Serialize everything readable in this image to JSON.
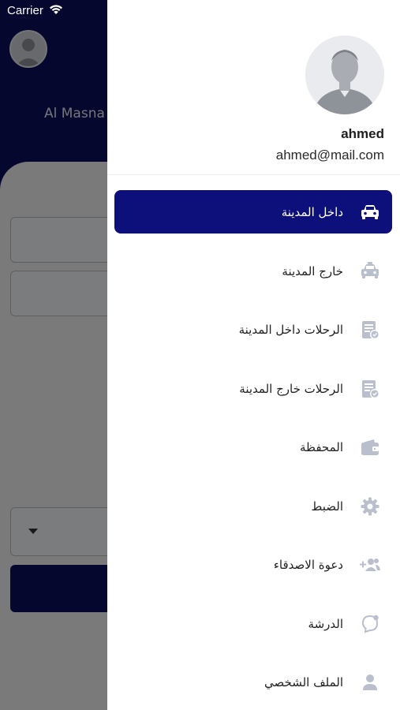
{
  "status_bar": {
    "carrier": "Carrier"
  },
  "background": {
    "location_text": "Al Masna"
  },
  "drawer": {
    "profile": {
      "name": "ahmed",
      "email": "ahmed@mail.com"
    },
    "items": [
      {
        "label": "داخل المدينة",
        "icon": "car-icon",
        "active": true
      },
      {
        "label": "خارج المدينة",
        "icon": "taxi-icon",
        "active": false
      },
      {
        "label": "الرحلات داخل المدينة",
        "icon": "trip-list-icon",
        "active": false
      },
      {
        "label": "الرحلات خارج المدينة",
        "icon": "trip-list-icon",
        "active": false
      },
      {
        "label": "المحفظة",
        "icon": "wallet-icon",
        "active": false
      },
      {
        "label": "الضبط",
        "icon": "gear-icon",
        "active": false
      },
      {
        "label": "دعوة الاصدقاء",
        "icon": "invite-friends-icon",
        "active": false
      },
      {
        "label": "الدرشة",
        "icon": "chat-icon",
        "active": false
      },
      {
        "label": "الملف الشخصي",
        "icon": "profile-icon",
        "active": false
      }
    ]
  },
  "colors": {
    "primary": "#0d0f7a",
    "icon_gray": "#b9bfcc"
  }
}
